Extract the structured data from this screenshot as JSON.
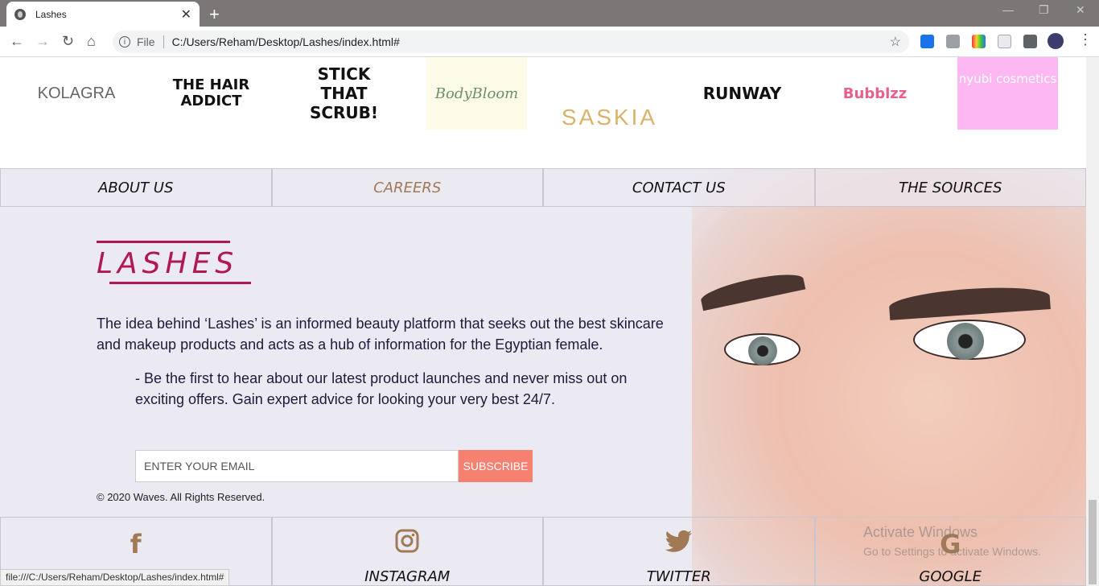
{
  "browser": {
    "tab_title": "Lashes",
    "new_tab": "+",
    "url_scheme_label": "File",
    "url": "C:/Users/Reham/Desktop/Lashes/index.html#",
    "status_url": "file:///C:/Users/Reham/Desktop/Lashes/index.html#"
  },
  "brands": [
    "KOLAGRA",
    "THE HAIR ADDICT",
    "STICK THAT SCRUB!",
    "BodyBloom",
    "SASKIA",
    "RUNWAY",
    "Bubblzz",
    "nyubi cosmetics"
  ],
  "nav": [
    "ABOUT US",
    "CAREERS",
    "CONTACT US",
    "THE SOURCES"
  ],
  "brand_title": "LASHES",
  "about": {
    "p1": "The idea behind ‘Lashes’ is an informed beauty platform that seeks out the best skincare and makeup products and acts as a hub of information for the Egyptian female.",
    "p2": "- Be the first to hear about our latest product launches and never miss out on exciting offers. Gain expert advice for looking your very best 24/7."
  },
  "subscribe": {
    "placeholder": "ENTER YOUR EMAIL",
    "button": "SUBSCRIBE"
  },
  "copyright": "©  2020 Waves. All Rights Reserved.",
  "social": [
    {
      "label": "FACEBOOK",
      "icon": "facebook-icon"
    },
    {
      "label": "INSTAGRAM",
      "icon": "instagram-icon"
    },
    {
      "label": "TWITTER",
      "icon": "twitter-icon"
    },
    {
      "label": "GOOGLE",
      "icon": "google-icon"
    }
  ],
  "watermark": {
    "line1": "Activate Windows",
    "line2": "Go to Settings to activate Windows."
  },
  "colors": {
    "accent": "#b0184f",
    "gold": "#a07a55",
    "subscribe": "#f78170",
    "footer_bg": "#ebe9f2"
  }
}
